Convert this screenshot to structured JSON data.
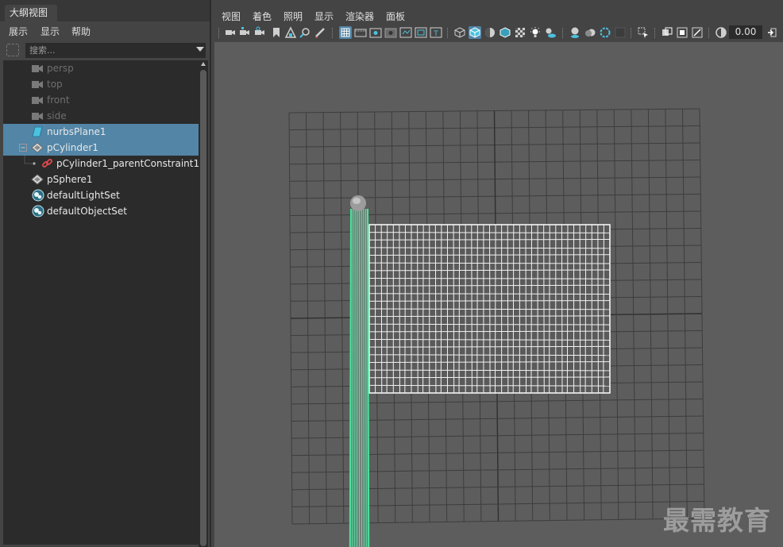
{
  "outliner": {
    "tab_title": "大纲视图",
    "menu": [
      "展示",
      "显示",
      "帮助"
    ],
    "search_placeholder": "搜索...",
    "items": [
      {
        "label": "persp",
        "icon": "camera-icon"
      },
      {
        "label": "top",
        "icon": "camera-icon"
      },
      {
        "label": "front",
        "icon": "camera-icon"
      },
      {
        "label": "side",
        "icon": "camera-icon"
      },
      {
        "label": "nurbsPlane1",
        "icon": "nurbs-surface-icon",
        "selected": true
      },
      {
        "label": "pCylinder1",
        "icon": "transform-icon",
        "selected": true,
        "expanded": true
      },
      {
        "label": "pCylinder1_parentConstraint1",
        "icon": "parent-constraint-icon"
      },
      {
        "label": "pSphere1",
        "icon": "transform-icon"
      },
      {
        "label": "defaultLightSet",
        "icon": "set-icon"
      },
      {
        "label": "defaultObjectSet",
        "icon": "set-icon"
      }
    ]
  },
  "viewport": {
    "menu": [
      "视图",
      "着色",
      "照明",
      "显示",
      "渲染器",
      "面板"
    ],
    "toolbar": {
      "exposure_value": "0.00",
      "icons": [
        "select-camera-icon",
        "camera-attributes-icon",
        "bookmark-icon",
        "image-plane-icon",
        "2d-pan-zoom-icon",
        "grease-pencil-icon",
        "grid-icon",
        "film-gate-icon",
        "resolution-gate-icon",
        "gate-mask-icon",
        "field-chart-icon",
        "safe-action-icon",
        "safe-title-icon",
        "wireframe-icon",
        "smooth-shade-icon",
        "default-material-icon",
        "wireframe-on-shaded-icon",
        "textured-icon",
        "use-all-lights-icon",
        "shadows-icon",
        "screen-space-ao-icon",
        "motion-blur-icon",
        "multisample-aa-icon",
        "depth-of-field-icon",
        "isolate-select-icon",
        "xray-icon",
        "xray-active-icon",
        "xray-joints-icon",
        "backface-culling-icon",
        "exposure-icon",
        "gamma-icon"
      ]
    },
    "watermark": "最需教育"
  },
  "colors": {
    "selection": "#5285a6",
    "viewport_bg": "#5d5d5d",
    "grid_line": "#3a3a3a",
    "cylinder_wire": "#4de3a0",
    "flag_wire": "#ffffff"
  }
}
